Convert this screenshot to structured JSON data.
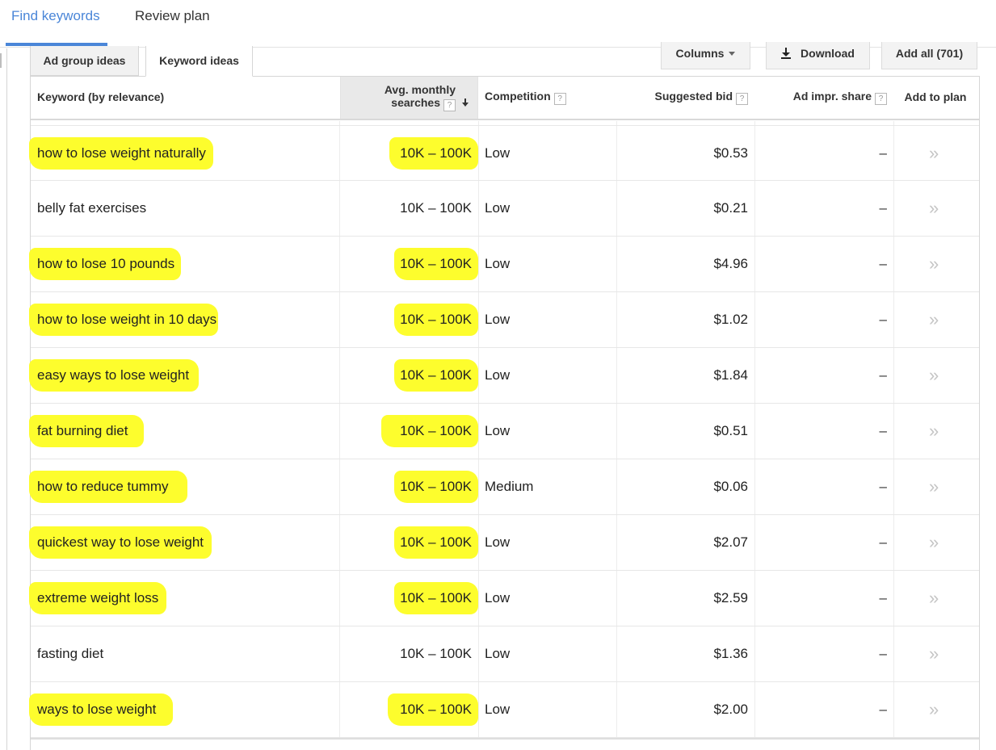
{
  "top_tabs": {
    "find": "Find keywords",
    "review": "Review plan"
  },
  "sub_tabs": {
    "adgroup": "Ad group ideas",
    "keyword": "Keyword ideas"
  },
  "toolbar": {
    "columns": "Columns",
    "download": "Download",
    "add_all": "Add all (701)"
  },
  "table": {
    "headers": {
      "keyword": "Keyword (by relevance)",
      "avg_line1": "Avg. monthly",
      "avg_line2": "searches",
      "competition": "Competition",
      "bid": "Suggested bid",
      "share": "Ad impr. share",
      "add": "Add to plan",
      "help": "?"
    },
    "add_glyph": "»",
    "rows": [
      {
        "keyword": "how to lose weight naturally",
        "avg": "10K – 100K",
        "competition": "Low",
        "bid": "$0.53",
        "share": "–",
        "highlighted": true
      },
      {
        "keyword": "belly fat exercises",
        "avg": "10K – 100K",
        "competition": "Low",
        "bid": "$0.21",
        "share": "–",
        "highlighted": false
      },
      {
        "keyword": "how to lose 10 pounds",
        "avg": "10K – 100K",
        "competition": "Low",
        "bid": "$4.96",
        "share": "–",
        "highlighted": true
      },
      {
        "keyword": "how to lose weight in 10 days",
        "avg": "10K – 100K",
        "competition": "Low",
        "bid": "$1.02",
        "share": "–",
        "highlighted": true
      },
      {
        "keyword": "easy ways to lose weight",
        "avg": "10K – 100K",
        "competition": "Low",
        "bid": "$1.84",
        "share": "–",
        "highlighted": true
      },
      {
        "keyword": "fat burning diet",
        "avg": "10K – 100K",
        "competition": "Low",
        "bid": "$0.51",
        "share": "–",
        "highlighted": true
      },
      {
        "keyword": "how to reduce tummy",
        "avg": "10K – 100K",
        "competition": "Medium",
        "bid": "$0.06",
        "share": "–",
        "highlighted": true
      },
      {
        "keyword": "quickest way to lose weight",
        "avg": "10K – 100K",
        "competition": "Low",
        "bid": "$2.07",
        "share": "–",
        "highlighted": true
      },
      {
        "keyword": "extreme weight loss",
        "avg": "10K – 100K",
        "competition": "Low",
        "bid": "$2.59",
        "share": "–",
        "highlighted": true
      },
      {
        "keyword": "fasting diet",
        "avg": "10K – 100K",
        "competition": "Low",
        "bid": "$1.36",
        "share": "–",
        "highlighted": false
      },
      {
        "keyword": "ways to lose weight",
        "avg": "10K – 100K",
        "competition": "Low",
        "bid": "$2.00",
        "share": "–",
        "highlighted": true
      }
    ]
  },
  "colors": {
    "accent": "#4a86d8",
    "highlight": "#fdfd2d",
    "add_arrow": "#c5c5c5"
  }
}
